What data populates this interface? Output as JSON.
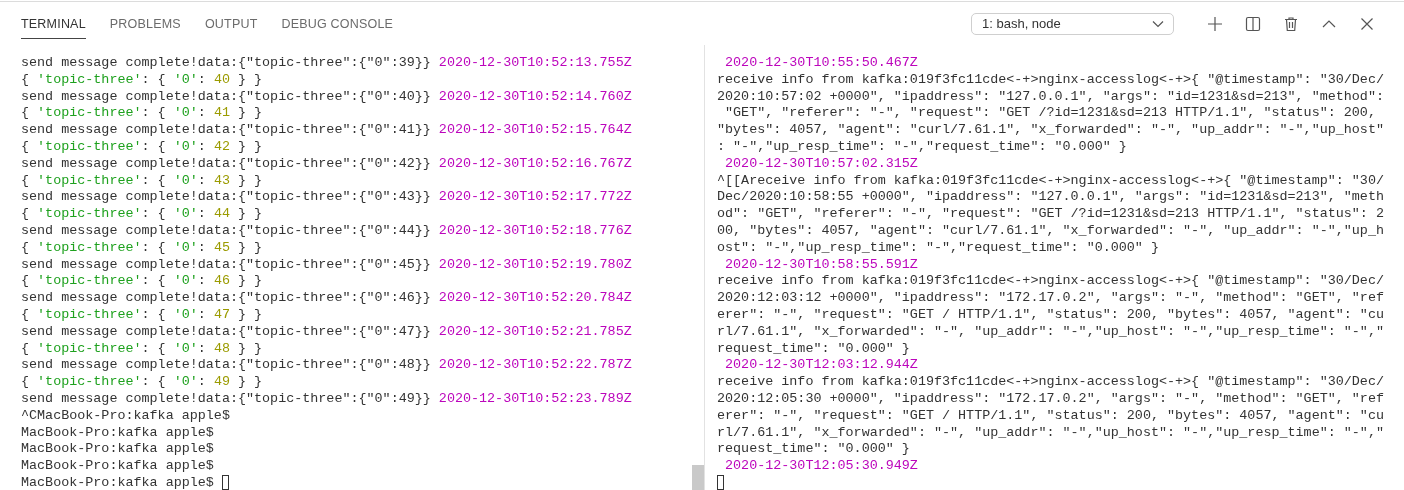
{
  "tabs": [
    {
      "label": "TERMINAL",
      "selected": true
    },
    {
      "label": "PROBLEMS",
      "selected": false
    },
    {
      "label": "OUTPUT",
      "selected": false
    },
    {
      "label": "DEBUG CONSOLE",
      "selected": false
    }
  ],
  "terminal_select": {
    "value": "1: bash, node"
  },
  "left_pane": {
    "cursor_on_last_line": true,
    "lines": [
      [
        {
          "text": "send message complete!data:{\"topic-three\":{\"0\":39}} ",
          "kind": "plain"
        },
        {
          "text": "2020-12-30T10:52:13.755Z",
          "kind": "timestamp"
        }
      ],
      [
        {
          "text": "{ ",
          "kind": "plain"
        },
        {
          "text": "'topic-three'",
          "kind": "string"
        },
        {
          "text": ": { ",
          "kind": "plain"
        },
        {
          "text": "'0'",
          "kind": "string"
        },
        {
          "text": ": ",
          "kind": "plain"
        },
        {
          "text": "40",
          "kind": "number"
        },
        {
          "text": " } }",
          "kind": "plain"
        }
      ],
      [
        {
          "text": "send message complete!data:{\"topic-three\":{\"0\":40}} ",
          "kind": "plain"
        },
        {
          "text": "2020-12-30T10:52:14.760Z",
          "kind": "timestamp"
        }
      ],
      [
        {
          "text": "{ ",
          "kind": "plain"
        },
        {
          "text": "'topic-three'",
          "kind": "string"
        },
        {
          "text": ": { ",
          "kind": "plain"
        },
        {
          "text": "'0'",
          "kind": "string"
        },
        {
          "text": ": ",
          "kind": "plain"
        },
        {
          "text": "41",
          "kind": "number"
        },
        {
          "text": " } }",
          "kind": "plain"
        }
      ],
      [
        {
          "text": "send message complete!data:{\"topic-three\":{\"0\":41}} ",
          "kind": "plain"
        },
        {
          "text": "2020-12-30T10:52:15.764Z",
          "kind": "timestamp"
        }
      ],
      [
        {
          "text": "{ ",
          "kind": "plain"
        },
        {
          "text": "'topic-three'",
          "kind": "string"
        },
        {
          "text": ": { ",
          "kind": "plain"
        },
        {
          "text": "'0'",
          "kind": "string"
        },
        {
          "text": ": ",
          "kind": "plain"
        },
        {
          "text": "42",
          "kind": "number"
        },
        {
          "text": " } }",
          "kind": "plain"
        }
      ],
      [
        {
          "text": "send message complete!data:{\"topic-three\":{\"0\":42}} ",
          "kind": "plain"
        },
        {
          "text": "2020-12-30T10:52:16.767Z",
          "kind": "timestamp"
        }
      ],
      [
        {
          "text": "{ ",
          "kind": "plain"
        },
        {
          "text": "'topic-three'",
          "kind": "string"
        },
        {
          "text": ": { ",
          "kind": "plain"
        },
        {
          "text": "'0'",
          "kind": "string"
        },
        {
          "text": ": ",
          "kind": "plain"
        },
        {
          "text": "43",
          "kind": "number"
        },
        {
          "text": " } }",
          "kind": "plain"
        }
      ],
      [
        {
          "text": "send message complete!data:{\"topic-three\":{\"0\":43}} ",
          "kind": "plain"
        },
        {
          "text": "2020-12-30T10:52:17.772Z",
          "kind": "timestamp"
        }
      ],
      [
        {
          "text": "{ ",
          "kind": "plain"
        },
        {
          "text": "'topic-three'",
          "kind": "string"
        },
        {
          "text": ": { ",
          "kind": "plain"
        },
        {
          "text": "'0'",
          "kind": "string"
        },
        {
          "text": ": ",
          "kind": "plain"
        },
        {
          "text": "44",
          "kind": "number"
        },
        {
          "text": " } }",
          "kind": "plain"
        }
      ],
      [
        {
          "text": "send message complete!data:{\"topic-three\":{\"0\":44}} ",
          "kind": "plain"
        },
        {
          "text": "2020-12-30T10:52:18.776Z",
          "kind": "timestamp"
        }
      ],
      [
        {
          "text": "{ ",
          "kind": "plain"
        },
        {
          "text": "'topic-three'",
          "kind": "string"
        },
        {
          "text": ": { ",
          "kind": "plain"
        },
        {
          "text": "'0'",
          "kind": "string"
        },
        {
          "text": ": ",
          "kind": "plain"
        },
        {
          "text": "45",
          "kind": "number"
        },
        {
          "text": " } }",
          "kind": "plain"
        }
      ],
      [
        {
          "text": "send message complete!data:{\"topic-three\":{\"0\":45}} ",
          "kind": "plain"
        },
        {
          "text": "2020-12-30T10:52:19.780Z",
          "kind": "timestamp"
        }
      ],
      [
        {
          "text": "{ ",
          "kind": "plain"
        },
        {
          "text": "'topic-three'",
          "kind": "string"
        },
        {
          "text": ": { ",
          "kind": "plain"
        },
        {
          "text": "'0'",
          "kind": "string"
        },
        {
          "text": ": ",
          "kind": "plain"
        },
        {
          "text": "46",
          "kind": "number"
        },
        {
          "text": " } }",
          "kind": "plain"
        }
      ],
      [
        {
          "text": "send message complete!data:{\"topic-three\":{\"0\":46}} ",
          "kind": "plain"
        },
        {
          "text": "2020-12-30T10:52:20.784Z",
          "kind": "timestamp"
        }
      ],
      [
        {
          "text": "{ ",
          "kind": "plain"
        },
        {
          "text": "'topic-three'",
          "kind": "string"
        },
        {
          "text": ": { ",
          "kind": "plain"
        },
        {
          "text": "'0'",
          "kind": "string"
        },
        {
          "text": ": ",
          "kind": "plain"
        },
        {
          "text": "47",
          "kind": "number"
        },
        {
          "text": " } }",
          "kind": "plain"
        }
      ],
      [
        {
          "text": "send message complete!data:{\"topic-three\":{\"0\":47}} ",
          "kind": "plain"
        },
        {
          "text": "2020-12-30T10:52:21.785Z",
          "kind": "timestamp"
        }
      ],
      [
        {
          "text": "{ ",
          "kind": "plain"
        },
        {
          "text": "'topic-three'",
          "kind": "string"
        },
        {
          "text": ": { ",
          "kind": "plain"
        },
        {
          "text": "'0'",
          "kind": "string"
        },
        {
          "text": ": ",
          "kind": "plain"
        },
        {
          "text": "48",
          "kind": "number"
        },
        {
          "text": " } }",
          "kind": "plain"
        }
      ],
      [
        {
          "text": "send message complete!data:{\"topic-three\":{\"0\":48}} ",
          "kind": "plain"
        },
        {
          "text": "2020-12-30T10:52:22.787Z",
          "kind": "timestamp"
        }
      ],
      [
        {
          "text": "{ ",
          "kind": "plain"
        },
        {
          "text": "'topic-three'",
          "kind": "string"
        },
        {
          "text": ": { ",
          "kind": "plain"
        },
        {
          "text": "'0'",
          "kind": "string"
        },
        {
          "text": ": ",
          "kind": "plain"
        },
        {
          "text": "49",
          "kind": "number"
        },
        {
          "text": " } }",
          "kind": "plain"
        }
      ],
      [
        {
          "text": "send message complete!data:{\"topic-three\":{\"0\":49}} ",
          "kind": "plain"
        },
        {
          "text": "2020-12-30T10:52:23.789Z",
          "kind": "timestamp"
        }
      ],
      [
        {
          "text": "^CMacBook-Pro:kafka apple$",
          "kind": "plain"
        }
      ],
      [
        {
          "text": "MacBook-Pro:kafka apple$",
          "kind": "plain"
        }
      ],
      [
        {
          "text": "MacBook-Pro:kafka apple$",
          "kind": "plain"
        }
      ],
      [
        {
          "text": "MacBook-Pro:kafka apple$",
          "kind": "plain"
        }
      ],
      [
        {
          "text": "MacBook-Pro:kafka apple$ ",
          "kind": "plain"
        }
      ]
    ]
  },
  "right_pane": {
    "cursor_on_last_line": false,
    "lines": [
      [
        {
          "text": " 2020-12-30T10:55:50.467Z",
          "kind": "timestamp"
        }
      ],
      [
        {
          "text": "receive info from kafka:019f3fc11cde<-+>nginx-accesslog<-+>{ \"@timestamp\": \"30/Dec/",
          "kind": "plain"
        }
      ],
      [
        {
          "text": "2020:10:57:02 +0000\", \"ipaddress\": \"127.0.0.1\", \"args\": \"id=1231&sd=213\", \"method\":",
          "kind": "plain"
        }
      ],
      [
        {
          "text": " \"GET\", \"referer\": \"-\", \"request\": \"GET /?id=1231&sd=213 HTTP/1.1\", \"status\": 200,",
          "kind": "plain"
        }
      ],
      [
        {
          "text": "\"bytes\": 4057, \"agent\": \"curl/7.61.1\", \"x_forwarded\": \"-\", \"up_addr\": \"-\",\"up_host\"",
          "kind": "plain"
        }
      ],
      [
        {
          "text": ": \"-\",\"up_resp_time\": \"-\",\"request_time\": \"0.000\" }",
          "kind": "plain"
        }
      ],
      [
        {
          "text": " 2020-12-30T10:57:02.315Z",
          "kind": "timestamp"
        }
      ],
      [
        {
          "text": "^[[Areceive info from kafka:019f3fc11cde<-+>nginx-accesslog<-+>{ \"@timestamp\": \"30/",
          "kind": "plain"
        }
      ],
      [
        {
          "text": "Dec/2020:10:58:55 +0000\", \"ipaddress\": \"127.0.0.1\", \"args\": \"id=1231&sd=213\", \"meth",
          "kind": "plain"
        }
      ],
      [
        {
          "text": "od\": \"GET\", \"referer\": \"-\", \"request\": \"GET /?id=1231&sd=213 HTTP/1.1\", \"status\": 2",
          "kind": "plain"
        }
      ],
      [
        {
          "text": "00, \"bytes\": 4057, \"agent\": \"curl/7.61.1\", \"x_forwarded\": \"-\", \"up_addr\": \"-\",\"up_h",
          "kind": "plain"
        }
      ],
      [
        {
          "text": "ost\": \"-\",\"up_resp_time\": \"-\",\"request_time\": \"0.000\" }",
          "kind": "plain"
        }
      ],
      [
        {
          "text": " 2020-12-30T10:58:55.591Z",
          "kind": "timestamp"
        }
      ],
      [
        {
          "text": "receive info from kafka:019f3fc11cde<-+>nginx-accesslog<-+>{ \"@timestamp\": \"30/Dec/",
          "kind": "plain"
        }
      ],
      [
        {
          "text": "2020:12:03:12 +0000\", \"ipaddress\": \"172.17.0.2\", \"args\": \"-\", \"method\": \"GET\", \"ref",
          "kind": "plain"
        }
      ],
      [
        {
          "text": "erer\": \"-\", \"request\": \"GET / HTTP/1.1\", \"status\": 200, \"bytes\": 4057, \"agent\": \"cu",
          "kind": "plain"
        }
      ],
      [
        {
          "text": "rl/7.61.1\", \"x_forwarded\": \"-\", \"up_addr\": \"-\",\"up_host\": \"-\",\"up_resp_time\": \"-\",\"",
          "kind": "plain"
        }
      ],
      [
        {
          "text": "request_time\": \"0.000\" }",
          "kind": "plain"
        }
      ],
      [
        {
          "text": " 2020-12-30T12:03:12.944Z",
          "kind": "timestamp"
        }
      ],
      [
        {
          "text": "receive info from kafka:019f3fc11cde<-+>nginx-accesslog<-+>{ \"@timestamp\": \"30/Dec/",
          "kind": "plain"
        }
      ],
      [
        {
          "text": "2020:12:05:30 +0000\", \"ipaddress\": \"172.17.0.2\", \"args\": \"-\", \"method\": \"GET\", \"ref",
          "kind": "plain"
        }
      ],
      [
        {
          "text": "erer\": \"-\", \"request\": \"GET / HTTP/1.1\", \"status\": 200, \"bytes\": 4057, \"agent\": \"cu",
          "kind": "plain"
        }
      ],
      [
        {
          "text": "rl/7.61.1\", \"x_forwarded\": \"-\", \"up_addr\": \"-\",\"up_host\": \"-\",\"up_resp_time\": \"-\",\"",
          "kind": "plain"
        }
      ],
      [
        {
          "text": "request_time\": \"0.000\" }",
          "kind": "plain"
        }
      ],
      [
        {
          "text": " 2020-12-30T12:05:30.949Z",
          "kind": "timestamp"
        }
      ]
    ]
  }
}
